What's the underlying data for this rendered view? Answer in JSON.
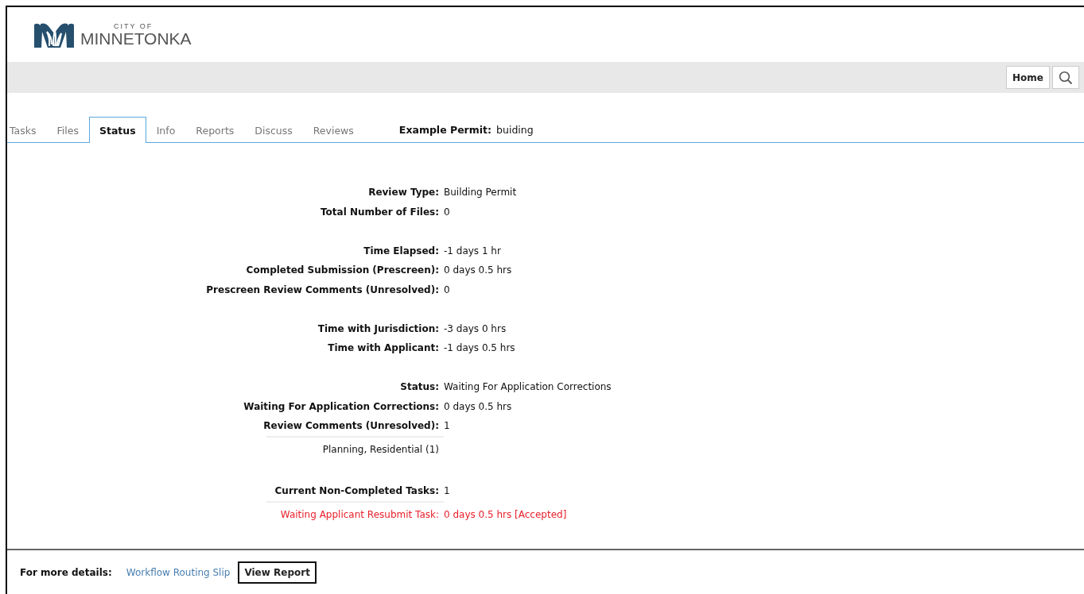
{
  "logo": {
    "small": "CITY OF",
    "name": "MINNETONKA"
  },
  "header": {
    "home_button": "Home"
  },
  "tabs": [
    {
      "label": "Tasks",
      "selected": false
    },
    {
      "label": "Files",
      "selected": false
    },
    {
      "label": "Status",
      "selected": true
    },
    {
      "label": "Info",
      "selected": false
    },
    {
      "label": "Reports",
      "selected": false
    },
    {
      "label": "Discuss",
      "selected": false
    },
    {
      "label": "Reviews",
      "selected": false
    }
  ],
  "permit": {
    "label": "Example Permit:",
    "value": "buiding"
  },
  "status_groups": [
    {
      "rows": [
        {
          "kind": "field",
          "label": "Review Type:",
          "value": "Building Permit"
        },
        {
          "kind": "field",
          "label": "Total Number of Files:",
          "value": "0"
        }
      ]
    },
    {
      "rows": [
        {
          "kind": "field",
          "label": "Time Elapsed:",
          "value": "-1 days 1 hr"
        },
        {
          "kind": "field",
          "label": "Completed Submission (Prescreen):",
          "value": "0 days 0.5 hrs"
        },
        {
          "kind": "field",
          "label": "Prescreen Review Comments (Unresolved):",
          "value": "0"
        }
      ]
    },
    {
      "rows": [
        {
          "kind": "field",
          "label": "Time with Jurisdiction:",
          "value": "-3 days 0 hrs"
        },
        {
          "kind": "field",
          "label": "Time with Applicant:",
          "value": "-1 days 0.5 hrs"
        }
      ]
    },
    {
      "rows": [
        {
          "kind": "field",
          "label": "Status:",
          "value": "Waiting For Application Corrections"
        },
        {
          "kind": "field",
          "label": "Waiting For Application Corrections:",
          "value": "0 days 0.5 hrs"
        },
        {
          "kind": "field",
          "label": "Review Comments (Unresolved):",
          "value": "1"
        },
        {
          "kind": "note",
          "label": "Planning, Residential (1)"
        }
      ]
    },
    {
      "rows": [
        {
          "kind": "field",
          "label": "Current Non-Completed Tasks:",
          "value": "1"
        },
        {
          "kind": "alert",
          "label": "Waiting Applicant Resubmit Task:",
          "value": "0 days 0.5 hrs [Accepted]"
        }
      ]
    }
  ],
  "footer": {
    "label": "For more details:",
    "link": "Workflow Routing Slip",
    "button": "View Report"
  }
}
